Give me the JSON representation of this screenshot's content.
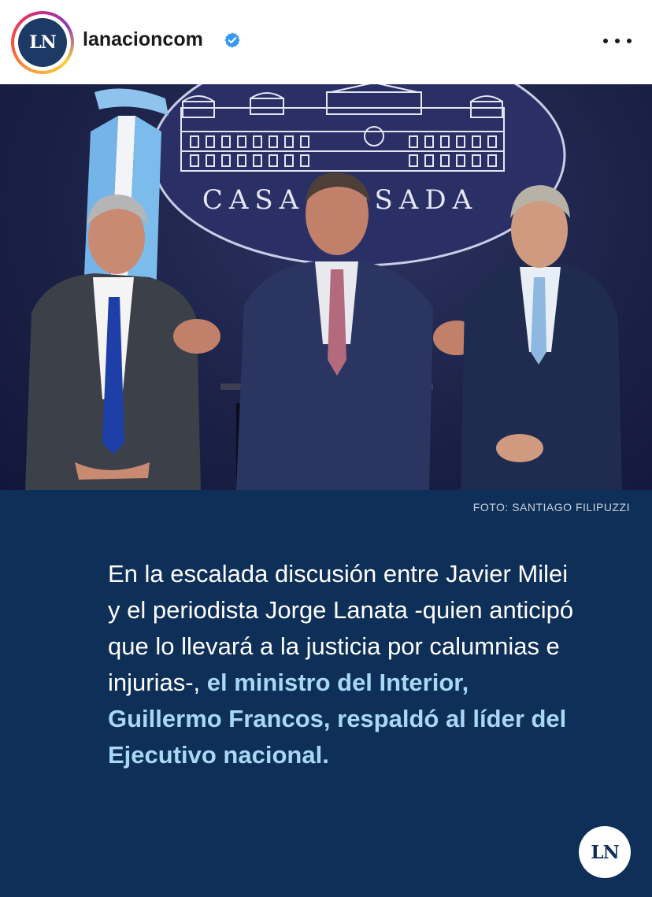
{
  "header": {
    "avatar_text": "LN",
    "username": "lanacioncom",
    "verified_icon": "verified-badge-icon",
    "more_icon": "more-options-icon"
  },
  "photo": {
    "sign_text": "CASA ROSADA",
    "credit": "FOTO: SANTIAGO FILIPUZZI"
  },
  "post": {
    "text_plain": "En la escalada discusión entre Javier Milei y el periodista Jorge Lanata -quien anticipó que lo llevará a la justicia por calumnias e injurias-, ",
    "text_highlight": "el ministro del Interior, Guillermo Francos, respaldó al líder del Ejecutivo nacional.",
    "badge_text": "LN"
  },
  "colors": {
    "panel_bg": "#0e2f57",
    "highlight": "#a9d8f5",
    "verified": "#3897f0"
  }
}
